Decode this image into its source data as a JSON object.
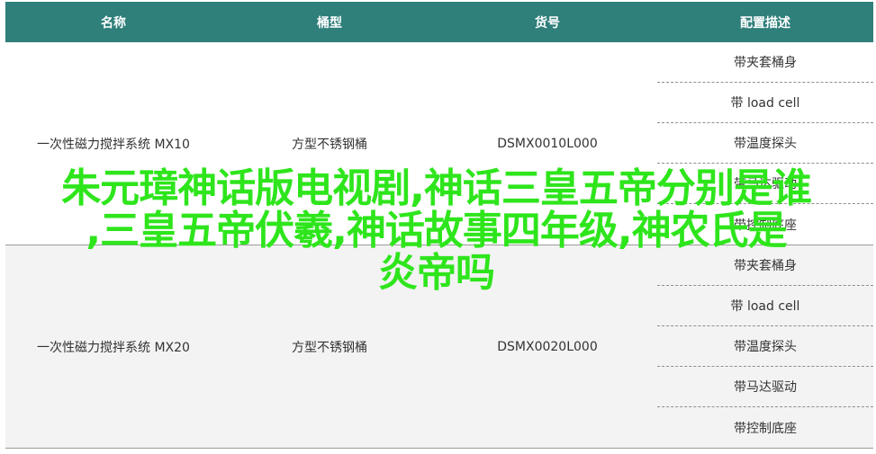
{
  "table": {
    "headers": {
      "name": "名称",
      "barrel": "桶型",
      "sku": "货号",
      "config": "配置描述"
    },
    "rows": [
      {
        "name": "一次性磁力搅拌系统 MX10",
        "barrel": "方型不锈钢桶",
        "sku": "DSMX0010L000",
        "configs": [
          "带夹套桶身",
          "带 load cell",
          "带温度探头",
          "带马达驱动",
          "带控制底座"
        ]
      },
      {
        "name": "一次性磁力搅拌系统 MX20",
        "barrel": "方型不锈钢桶",
        "sku": "DSMX0020L000",
        "configs": [
          "带夹套桶身",
          "带 load cell",
          "带温度探头",
          "带马达驱动",
          "带控制底座"
        ]
      }
    ]
  },
  "overlay": {
    "line1": "朱元璋神话版电视剧,神话三皇五帝分别是谁",
    "line2": ",三皇五帝伏羲,神话故事四年级,神农氏是",
    "line3": "炎帝吗",
    "color": "#2ee51c"
  },
  "colors": {
    "header_bg": "#2f7f7a",
    "alt_row_bg": "#f3f3f3"
  }
}
